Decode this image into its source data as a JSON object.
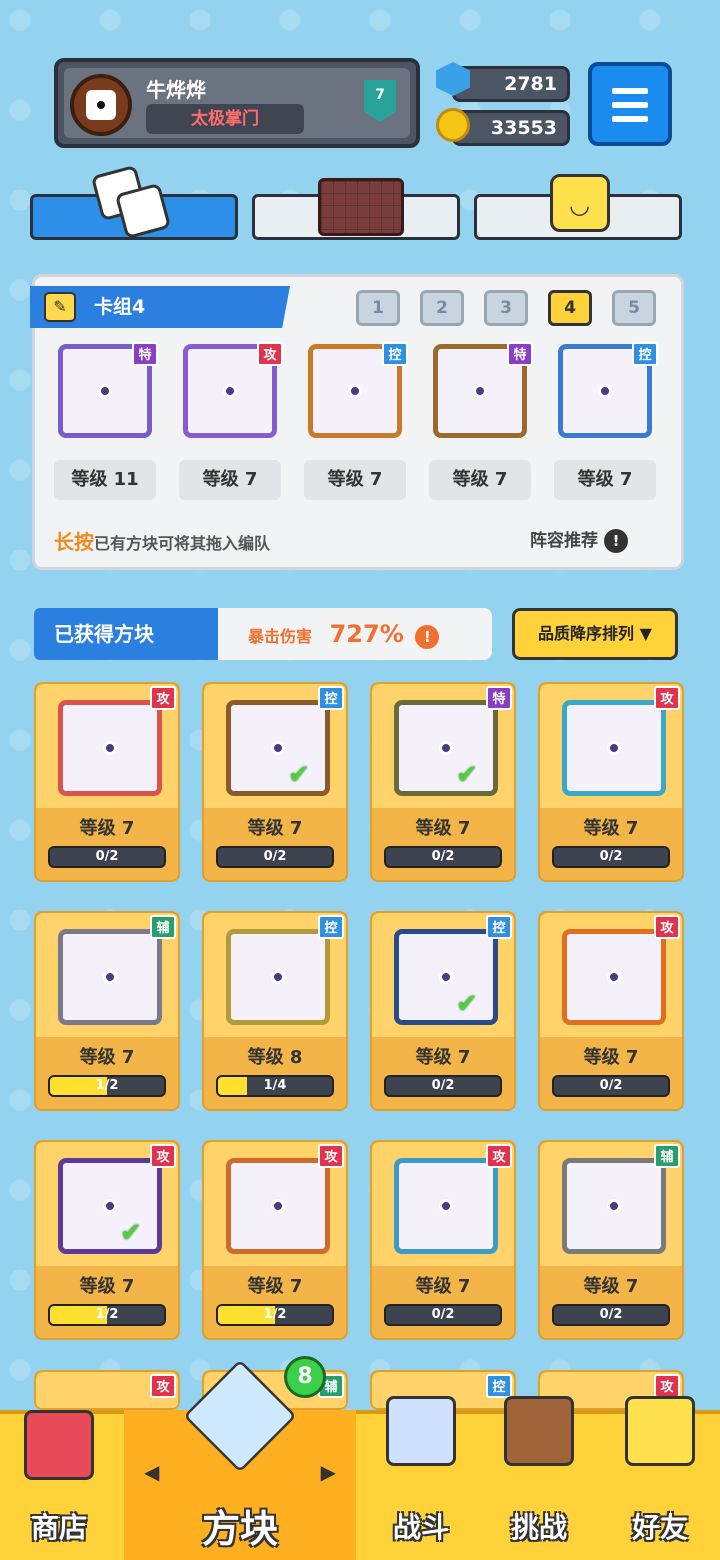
{
  "profile": {
    "name": "牛烨烨",
    "title": "太极掌门",
    "rank": "7"
  },
  "currency": {
    "gems": "2781",
    "coins": "33553"
  },
  "deck": {
    "title": "卡组4",
    "numbers": [
      "1",
      "2",
      "3",
      "4",
      "5"
    ],
    "selected": 4,
    "cards": [
      {
        "tag": "特",
        "level": "等级 11",
        "color": "#7b5bc9"
      },
      {
        "tag": "攻",
        "level": "等级 7",
        "color": "#8a5bd0"
      },
      {
        "tag": "控",
        "level": "等级 7",
        "color": "#c87a2a"
      },
      {
        "tag": "特",
        "level": "等级 7",
        "color": "#9a6a2a"
      },
      {
        "tag": "控",
        "level": "等级 7",
        "color": "#3a7ad0"
      }
    ],
    "hint_key": "长按",
    "hint_rest": "已有方块可将其拖入编队",
    "recommend": "阵容推荐"
  },
  "owned": {
    "title": "已获得方块",
    "crit_label": "暴击伤害",
    "crit_value": "727%",
    "sort": "品质降序排列 ▼"
  },
  "grid": [
    {
      "tag": "攻",
      "level": "等级 7",
      "progress": "0/2",
      "fill": 0,
      "color": "#d9534f",
      "check": false
    },
    {
      "tag": "控",
      "level": "等级 7",
      "progress": "0/2",
      "fill": 0,
      "color": "#8a5a2a",
      "check": true
    },
    {
      "tag": "特",
      "level": "等级 7",
      "progress": "0/2",
      "fill": 0,
      "color": "#6a6a3a",
      "check": true
    },
    {
      "tag": "攻",
      "level": "等级 7",
      "progress": "0/2",
      "fill": 0,
      "color": "#3aa8c8",
      "check": false
    },
    {
      "tag": "辅",
      "level": "等级 7",
      "progress": "1/2",
      "fill": 0.5,
      "color": "#7a7a8a",
      "check": false
    },
    {
      "tag": "控",
      "level": "等级 8",
      "progress": "1/4",
      "fill": 0.25,
      "color": "#b09a3a",
      "check": false
    },
    {
      "tag": "控",
      "level": "等级 7",
      "progress": "0/2",
      "fill": 0,
      "color": "#2a4a8a",
      "check": true
    },
    {
      "tag": "攻",
      "level": "等级 7",
      "progress": "0/2",
      "fill": 0,
      "color": "#e07020",
      "check": false
    },
    {
      "tag": "攻",
      "level": "等级 7",
      "progress": "1/2",
      "fill": 0.5,
      "color": "#5a3a9a",
      "check": true
    },
    {
      "tag": "攻",
      "level": "等级 7",
      "progress": "1/2",
      "fill": 0.5,
      "color": "#d06a2a",
      "check": false
    },
    {
      "tag": "攻",
      "level": "等级 7",
      "progress": "0/2",
      "fill": 0,
      "color": "#3a9ac8",
      "check": false
    },
    {
      "tag": "辅",
      "level": "等级 7",
      "progress": "0/2",
      "fill": 0,
      "color": "#7a7a7a",
      "check": false
    }
  ],
  "partial_row_tags": [
    "攻",
    "辅",
    "控",
    "攻"
  ],
  "nav": {
    "shop": "商店",
    "block": "方块",
    "battle": "战斗",
    "challenge": "挑战",
    "friends": "好友",
    "badge": "8",
    "arrow_left": "◀",
    "arrow_right": "▶"
  },
  "icons": {
    "pencil": "✎",
    "check": "✔",
    "exclaim": "!"
  }
}
